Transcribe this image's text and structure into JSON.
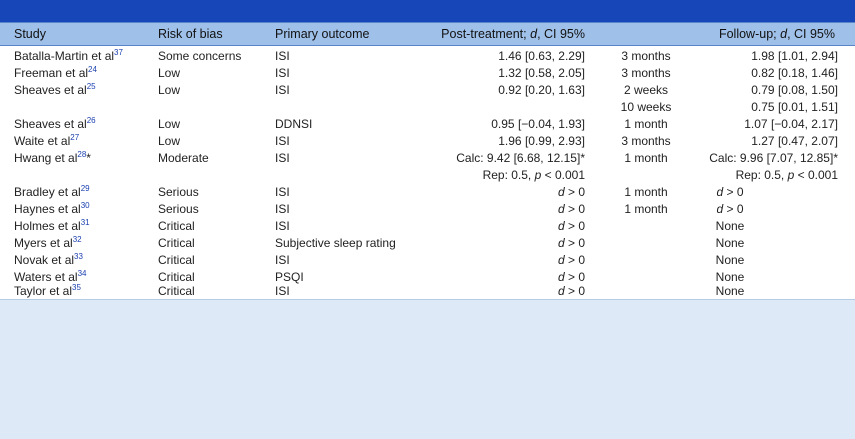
{
  "headers": {
    "study": "Study",
    "risk": "Risk of bias",
    "outcome": "Primary outcome",
    "post_pre": "Post-treatment; ",
    "post_d": "d",
    "post_post": ", CI 95%",
    "fu_pre": "Follow-up; ",
    "fu_d": "d",
    "fu_post": ", CI 95%"
  },
  "rows": [
    {
      "name": "Batalla-Martin et al",
      "ref": "37",
      "risk": "Some concerns",
      "outcome": "ISI",
      "post": "1.46 [0.63, 2.29]",
      "fu_time": "3 months",
      "fu_val": "1.98 [1.01, 2.94]"
    },
    {
      "name": "Freeman et al",
      "ref": "24",
      "risk": "Low",
      "outcome": "ISI",
      "post": "1.32 [0.58, 2.05]",
      "fu_time": "3 months",
      "fu_val": "0.82 [0.18, 1.46]"
    },
    {
      "name": "Sheaves et al",
      "ref": "25",
      "risk": "Low",
      "outcome": "ISI",
      "post": "0.92 [0.20, 1.63]",
      "fu_time": "2 weeks",
      "fu_val": "0.79 [0.08, 1.50]"
    },
    {
      "fu_time": "10 weeks",
      "fu_val": "0.75 [0.01, 1.51]"
    },
    {
      "name": "Sheaves et al",
      "ref": "26",
      "risk": "Low",
      "outcome": "DDNSI",
      "post": "0.95 [−0.04, 1.93]",
      "fu_time": "1 month",
      "fu_val": "1.07 [−0.04, 2.17]"
    },
    {
      "name": "Waite et al",
      "ref": "27",
      "risk": "Low",
      "outcome": "ISI",
      "post": "1.96 [0.99, 2.93]",
      "fu_time": "3 months",
      "fu_val": "1.27 [0.47, 2.07]"
    },
    {
      "name": "Hwang et al",
      "ref": "28",
      "suffix": "*",
      "risk": "Moderate",
      "outcome": "ISI",
      "post": "Calc: 9.42 [6.68, 12.15]*",
      "fu_time": "1 month",
      "fu_val": "Calc: 9.96 [7.07, 12.85]*"
    },
    {
      "post_rep_pre": "Rep: 0.5, ",
      "post_rep_p": "p",
      "post_rep_post": " < 0.001",
      "fu_rep_pre": "Rep: 0.5, ",
      "fu_rep_p": "p",
      "fu_rep_post": " < 0.001"
    },
    {
      "name": "Bradley et al",
      "ref": "29",
      "risk": "Serious",
      "outcome": "ISI",
      "post_d": "d",
      "post_rest": " > 0",
      "fu_time": "1 month",
      "fu_d": "d",
      "fu_rest": " > 0"
    },
    {
      "name": "Haynes et al",
      "ref": "30",
      "risk": "Serious",
      "outcome": "ISI",
      "post_d": "d",
      "post_rest": " > 0",
      "fu_time": "1 month",
      "fu_d": "d",
      "fu_rest": " > 0"
    },
    {
      "name": "Holmes et al",
      "ref": "31",
      "risk": "Critical",
      "outcome": "ISI",
      "post_d": "d",
      "post_rest": " > 0",
      "fu_none": "None"
    },
    {
      "name": "Myers et al",
      "ref": "32",
      "risk": "Critical",
      "outcome": "Subjective sleep rating",
      "post_d": "d",
      "post_rest": " > 0",
      "fu_none": "None"
    },
    {
      "name": "Novak et al",
      "ref": "33",
      "risk": "Critical",
      "outcome": "ISI",
      "post_d": "d",
      "post_rest": " > 0",
      "fu_none": "None"
    },
    {
      "name": "Waters et al",
      "ref": "34",
      "risk": "Critical",
      "outcome": "PSQI",
      "post_d": "d",
      "post_rest": " > 0",
      "fu_none": "None"
    },
    {
      "name": "Taylor et al",
      "ref": "35",
      "risk": "Critical",
      "outcome": "ISI",
      "post_d": "d",
      "post_rest": " > 0",
      "fu_none": "None"
    }
  ]
}
